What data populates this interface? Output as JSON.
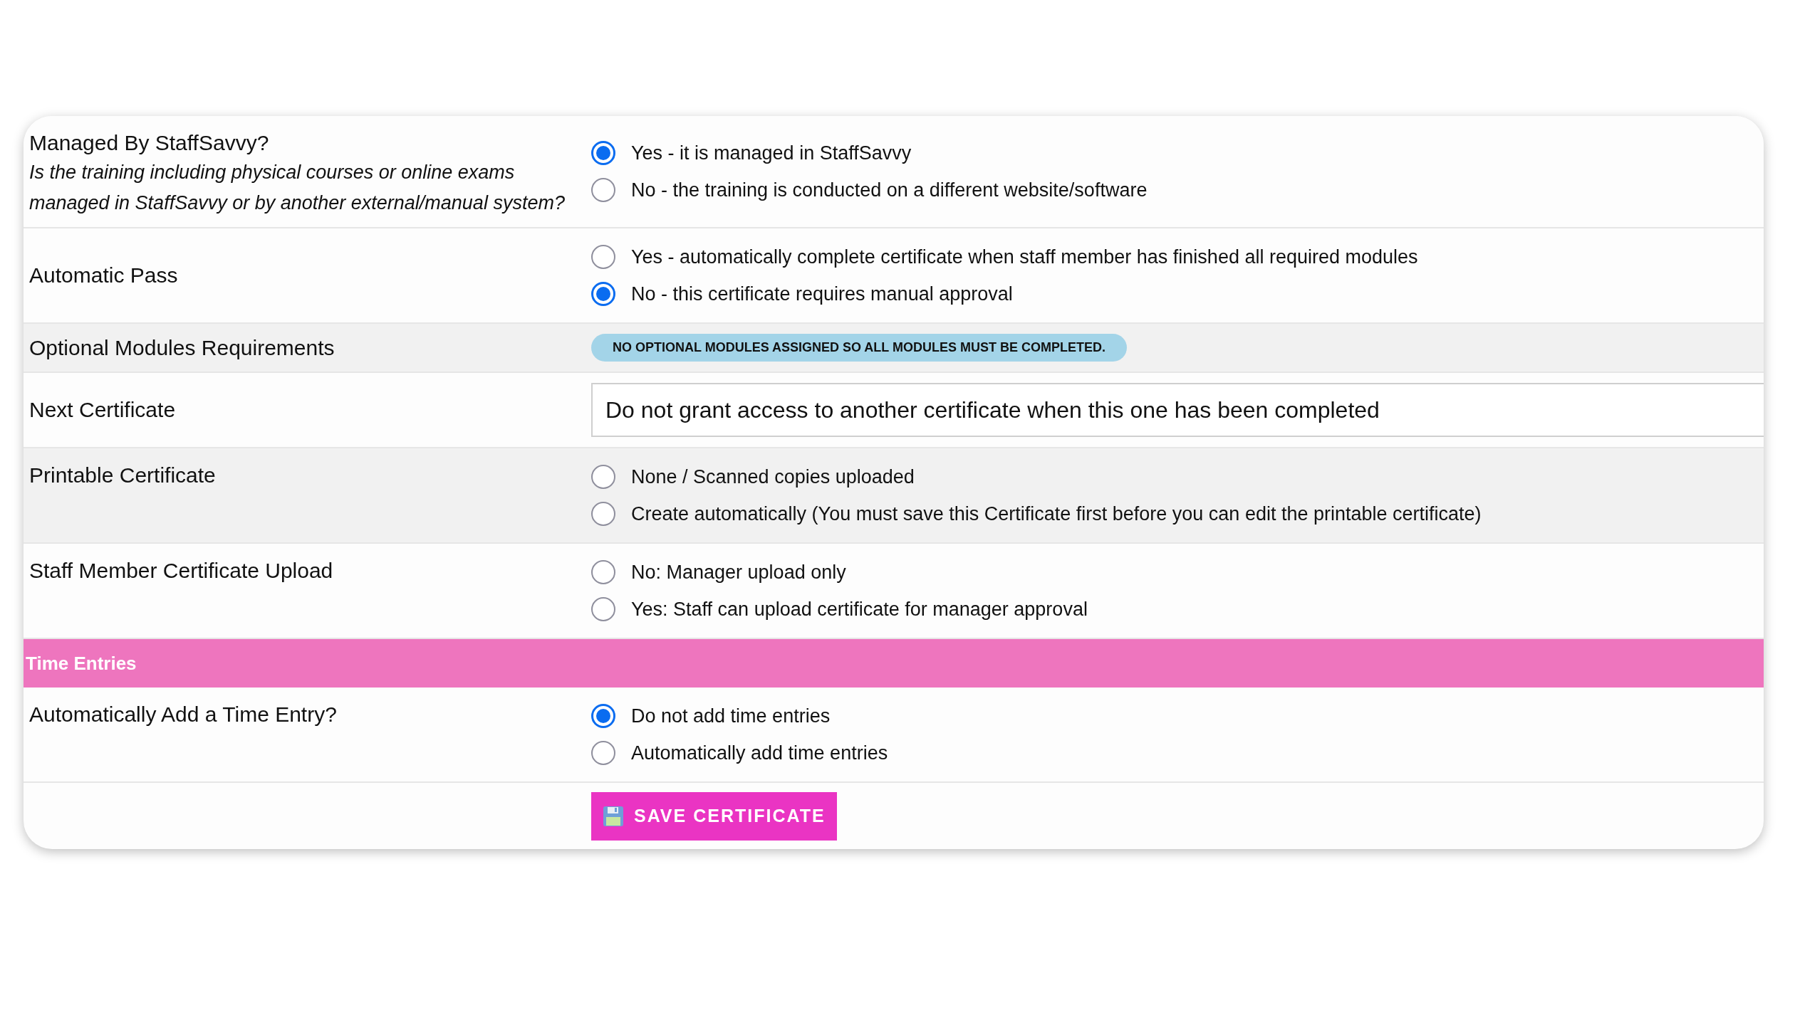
{
  "rows": [
    {
      "kind": "radio",
      "label": "Managed By StaffSavvy?",
      "description": "Is the training including physical courses or online exams managed in StaffSavvy or by another external/manual system?",
      "options": [
        {
          "label": "Yes - it is managed in StaffSavvy",
          "selected": true
        },
        {
          "label": "No - the training is conducted on a different website/software",
          "selected": false
        }
      ]
    },
    {
      "kind": "radio",
      "label": "Automatic Pass",
      "options": [
        {
          "label": "Yes - automatically complete certificate when staff member has finished all required modules",
          "selected": false
        },
        {
          "label": "No - this certificate requires manual approval",
          "selected": true
        }
      ]
    },
    {
      "kind": "badge",
      "label": "Optional Modules Requirements",
      "badge": "NO OPTIONAL MODULES ASSIGNED SO ALL MODULES MUST BE COMPLETED."
    },
    {
      "kind": "select",
      "label": "Next Certificate",
      "value": "Do not grant access to another certificate when this one has been completed"
    },
    {
      "kind": "radio",
      "label": "Printable Certificate",
      "options": [
        {
          "label": "None / Scanned copies uploaded",
          "selected": false
        },
        {
          "label": "Create automatically (You must save this Certificate first before you can edit the printable certificate)",
          "selected": false
        }
      ]
    },
    {
      "kind": "radio",
      "label": "Staff Member Certificate Upload",
      "options": [
        {
          "label": "No: Manager upload only",
          "selected": false
        },
        {
          "label": "Yes: Staff can upload certificate for manager approval",
          "selected": false
        }
      ]
    },
    {
      "kind": "section",
      "label": "Time Entries"
    },
    {
      "kind": "radio",
      "label": "Automatically Add a Time Entry?",
      "options": [
        {
          "label": "Do not add time entries",
          "selected": true
        },
        {
          "label": "Automatically add time entries",
          "selected": false
        }
      ]
    }
  ],
  "save_button": "SAVE CERTIFICATE"
}
